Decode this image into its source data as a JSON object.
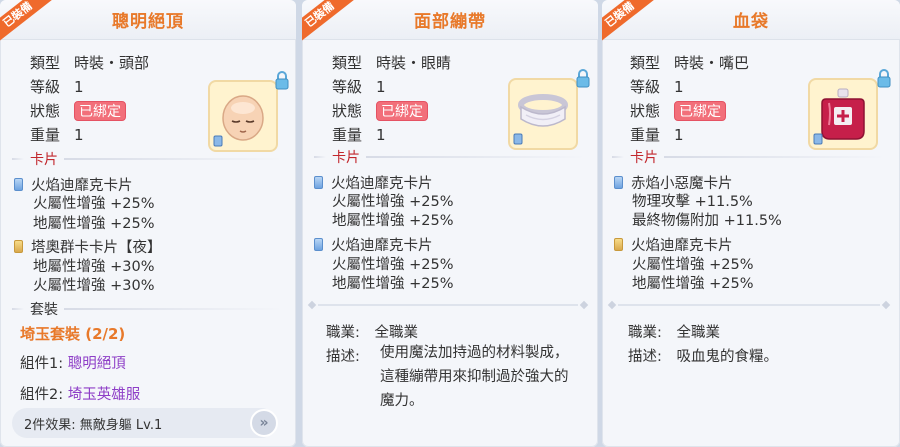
{
  "panels": [
    {
      "ribbon": "已裝備",
      "title": "聰明絕頂",
      "type_label": "類型",
      "type_value": "時裝・頭部",
      "level_label": "等級",
      "level_value": "1",
      "state_label": "狀態",
      "state_value": "已綁定",
      "weight_label": "重量",
      "weight_value": "1",
      "section_label": "卡片",
      "cards": [
        {
          "name": "火焰迪靡克卡片",
          "icon": "blue-card-icon",
          "stats": [
            "火屬性增強 +25%",
            "地屬性增強 +25%"
          ]
        },
        {
          "name": "塔奧群卡卡片【夜】",
          "icon": "gold-card-icon",
          "stats": [
            "地屬性增強 +30%",
            "火屬性增強 +30%"
          ]
        }
      ],
      "set_section_label": "套裝",
      "set_name": "埼玉套裝 (2/2)",
      "set_comp1_label": "組件1: ",
      "set_comp1_value": "聰明絕頂",
      "set_comp2_label": "組件2: ",
      "set_comp2_value": "埼玉英雄服",
      "set_effect": "2件效果: 無敵身軀 Lv.1",
      "more_label": "»"
    },
    {
      "ribbon": "已裝備",
      "title": "面部繃帶",
      "type_label": "類型",
      "type_value": "時裝・眼睛",
      "level_label": "等級",
      "level_value": "1",
      "state_label": "狀態",
      "state_value": "已綁定",
      "weight_label": "重量",
      "weight_value": "1",
      "section_label": "卡片",
      "cards": [
        {
          "name": "火焰迪靡克卡片",
          "icon": "blue-card-icon",
          "stats": [
            "火屬性增強 +25%",
            "地屬性增強 +25%"
          ]
        },
        {
          "name": "火焰迪靡克卡片",
          "icon": "blue-card-icon",
          "stats": [
            "火屬性增強 +25%",
            "地屬性增強 +25%"
          ]
        }
      ],
      "job_label": "職業:",
      "job_value": "全職業",
      "desc_label": "描述:",
      "desc_value": "使用魔法加持過的材料製成，這種繃帶用來抑制過於強大的魔力。"
    },
    {
      "ribbon": "已裝備",
      "title": "血袋",
      "type_label": "類型",
      "type_value": "時裝・嘴巴",
      "level_label": "等級",
      "level_value": "1",
      "state_label": "狀態",
      "state_value": "已綁定",
      "weight_label": "重量",
      "weight_value": "1",
      "section_label": "卡片",
      "cards": [
        {
          "name": "赤焰小惡魔卡片",
          "icon": "blue-card-icon",
          "stats": [
            "物理攻擊 +11.5%",
            "最終物傷附加 +11.5%"
          ]
        },
        {
          "name": "火焰迪靡克卡片",
          "icon": "gold-card-icon",
          "stats": [
            "火屬性增強 +25%",
            "地屬性增強 +25%"
          ]
        }
      ],
      "job_label": "職業:",
      "job_value": "全職業",
      "desc_label": "描述:",
      "desc_value": "吸血鬼的食糧。"
    }
  ],
  "colors": {
    "title_orange": "#e8792a",
    "section_red": "#c2272d",
    "bound_badge": "#f26f7a",
    "set_component_purple": "#8e3ec7",
    "ribbon_orange": "#ef6a2c"
  }
}
